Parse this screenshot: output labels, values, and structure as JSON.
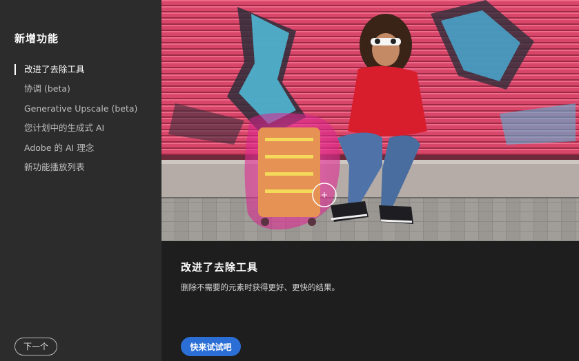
{
  "sidebar": {
    "title": "新增功能",
    "items": [
      {
        "label": "改进了去除工具",
        "active": true
      },
      {
        "label": "协调 (beta)",
        "active": false
      },
      {
        "label": "Generative Upscale (beta)",
        "active": false
      },
      {
        "label": "您计划中的生成式 AI",
        "active": false
      },
      {
        "label": "Adobe 的 AI 理念",
        "active": false
      },
      {
        "label": "新功能播放列表",
        "active": false
      }
    ],
    "next_label": "下一个"
  },
  "main": {
    "title": "改进了去除工具",
    "description": "删除不需要的元素时获得更好、更快的结果。",
    "try_label": "快来试试吧"
  },
  "colors": {
    "sidebar_bg": "#2c2c2c",
    "main_bg": "#1e1e1e",
    "accent": "#2b6fd6",
    "remove_highlight": "#e0359a"
  },
  "icons": {
    "brush_cursor": "crosshair-circle-icon"
  }
}
